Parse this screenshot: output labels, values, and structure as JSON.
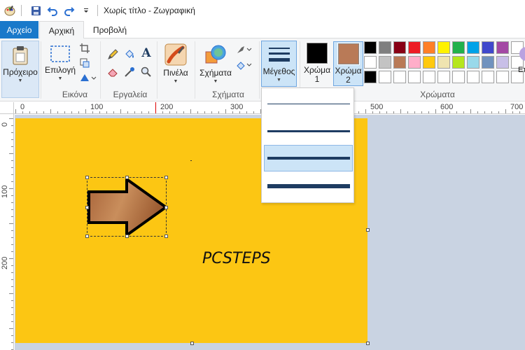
{
  "window": {
    "title": "Χωρίς τίτλο - Ζωγραφική"
  },
  "tabs": {
    "file": "Αρχείο",
    "home": "Αρχική",
    "view": "Προβολή"
  },
  "ribbon": {
    "clipboard": {
      "label": "Πρόχειρο"
    },
    "image": {
      "select_label": "Επιλογή",
      "group_label": "Εικόνα"
    },
    "tools": {
      "group_label": "Εργαλεία"
    },
    "brushes": {
      "label": "Πινέλα"
    },
    "shapes": {
      "label": "Σχήματα",
      "group_label": "Σχήματα"
    },
    "size": {
      "label": "Μέγεθος"
    },
    "color1": {
      "label_line1": "Χρώμα",
      "label_line2": "1",
      "color": "#000000"
    },
    "color2": {
      "label_line1": "Χρώμα",
      "label_line2": "2",
      "color": "#b97a57"
    },
    "colors_group_label": "Χρώματα",
    "edit_colors_partial": "Επ",
    "palette": [
      "#000000",
      "#7f7f7f",
      "#880015",
      "#ed1c24",
      "#ff7f27",
      "#fff200",
      "#22b14c",
      "#00a2e8",
      "#3f48cc",
      "#a349a4",
      "#ffffff",
      "#ffffff",
      "#ffffff",
      "#c3c3c3",
      "#b97a57",
      "#ffaec9",
      "#ffc90e",
      "#efe4b0",
      "#b5e61d",
      "#99d9ea",
      "#7092be",
      "#c8bfe7",
      "#ffffff",
      "#ffffff",
      "#000000",
      "#ffffff",
      "#ffffff",
      "#ffffff",
      "#ffffff",
      "#ffffff",
      "#ffffff",
      "#ffffff",
      "#ffffff",
      "#ffffff",
      "#ffffff",
      "#ffffff"
    ]
  },
  "ruler": {
    "h_labels": [
      "0",
      "100",
      "200",
      "300",
      "500",
      "600",
      "700"
    ],
    "v_labels": [
      "0",
      "100",
      "200"
    ]
  },
  "canvas": {
    "text": "PCSTEPS",
    "background": "#fcc613"
  },
  "size_dropdown": {
    "selected_index": 2
  }
}
